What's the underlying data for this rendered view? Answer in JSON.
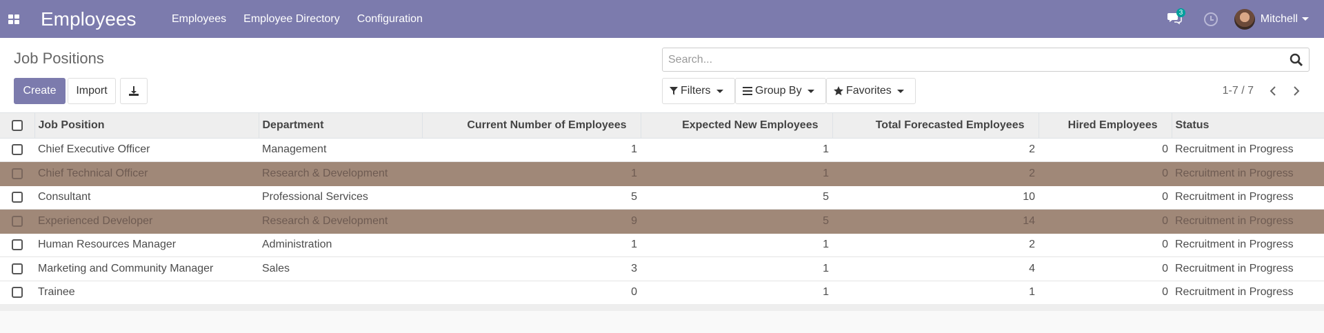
{
  "navbar": {
    "brand": "Employees",
    "menu": [
      "Employees",
      "Employee Directory",
      "Configuration"
    ],
    "chat_count": "3",
    "user_name": "Mitchell",
    "icons": [
      "apps-icon",
      "chat-icon",
      "clock-icon",
      "avatar"
    ]
  },
  "control": {
    "breadcrumb": "Job Positions",
    "create_label": "Create",
    "import_label": "Import",
    "search_placeholder": "Search...",
    "filters_label": "Filters",
    "groupby_label": "Group By",
    "favorites_label": "Favorites",
    "pager": "1-7 / 7"
  },
  "table": {
    "columns": [
      "Job Position",
      "Department",
      "Current Number of Employees",
      "Expected New Employees",
      "Total Forecasted Employees",
      "Hired Employees",
      "Status"
    ],
    "rows": [
      {
        "position": "Chief Executive Officer",
        "department": "Management",
        "current": "1",
        "expected": "1",
        "total": "2",
        "hired": "0",
        "status": "Recruitment in Progress",
        "muted": false
      },
      {
        "position": "Chief Technical Officer",
        "department": "Research & Development",
        "current": "1",
        "expected": "1",
        "total": "2",
        "hired": "0",
        "status": "Recruitment in Progress",
        "muted": true
      },
      {
        "position": "Consultant",
        "department": "Professional Services",
        "current": "5",
        "expected": "5",
        "total": "10",
        "hired": "0",
        "status": "Recruitment in Progress",
        "muted": false
      },
      {
        "position": "Experienced Developer",
        "department": "Research & Development",
        "current": "9",
        "expected": "5",
        "total": "14",
        "hired": "0",
        "status": "Recruitment in Progress",
        "muted": true
      },
      {
        "position": "Human Resources Manager",
        "department": "Administration",
        "current": "1",
        "expected": "1",
        "total": "2",
        "hired": "0",
        "status": "Recruitment in Progress",
        "muted": false
      },
      {
        "position": "Marketing and Community Manager",
        "department": "Sales",
        "current": "3",
        "expected": "1",
        "total": "4",
        "hired": "0",
        "status": "Recruitment in Progress",
        "muted": false
      },
      {
        "position": "Trainee",
        "department": "",
        "current": "0",
        "expected": "1",
        "total": "1",
        "hired": "0",
        "status": "Recruitment in Progress",
        "muted": false
      }
    ]
  },
  "colors": {
    "brand": "#7c7bad",
    "muted_row": "#a08878",
    "chat_badge": "#00a09d"
  }
}
